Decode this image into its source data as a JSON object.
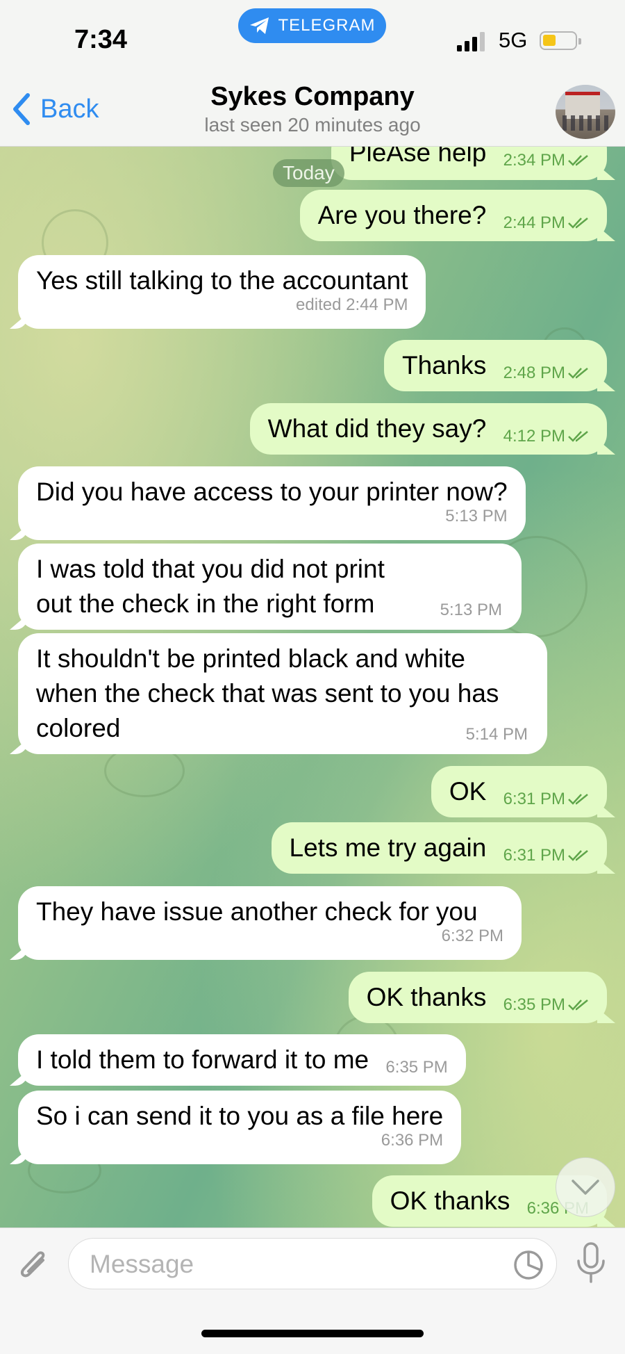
{
  "status_bar": {
    "time": "7:34",
    "app_badge": "TELEGRAM",
    "network": "5G",
    "icons": [
      "telegram-icon",
      "signal-icon",
      "battery-icon"
    ]
  },
  "header": {
    "back_label": "Back",
    "chat_title": "Sykes Company",
    "subtitle": "last seen 20 minutes ago"
  },
  "date_chip": "Today",
  "messages": [
    {
      "dir": "out",
      "text": "PleAse help",
      "time": "2:34 PM",
      "read": true
    },
    {
      "dir": "out",
      "text": "Are you there?",
      "time": "2:44 PM",
      "read": true
    },
    {
      "dir": "in",
      "text": "Yes still talking to the accountant",
      "time": "edited 2:44 PM"
    },
    {
      "dir": "out",
      "text": "Thanks",
      "time": "2:48 PM",
      "read": true
    },
    {
      "dir": "out",
      "text": "What did they say?",
      "time": "4:12 PM",
      "read": true
    },
    {
      "dir": "in",
      "text": "Did you have access to your printer now?",
      "time": "5:13 PM"
    },
    {
      "dir": "in",
      "text": "I was told that you did not print out the check in the right form",
      "time": "5:13 PM"
    },
    {
      "dir": "in",
      "text": "It shouldn't be printed black and white when the check that was sent to you has colored",
      "time": "5:14 PM"
    },
    {
      "dir": "out",
      "text": "OK",
      "time": "6:31 PM",
      "read": true
    },
    {
      "dir": "out",
      "text": "Lets me try again",
      "time": "6:31 PM",
      "read": true
    },
    {
      "dir": "in",
      "text": "They have issue another check for you",
      "time": "6:32 PM"
    },
    {
      "dir": "out",
      "text": "OK thanks",
      "time": "6:35 PM",
      "read": true
    },
    {
      "dir": "in",
      "text": "I told them to forward it to me",
      "time": "6:35 PM"
    },
    {
      "dir": "in",
      "text": "So i can send it to you as a file here",
      "time": "6:36 PM"
    },
    {
      "dir": "out",
      "text": "OK thanks",
      "time": "6:36 PM",
      "read": true
    }
  ],
  "composer": {
    "placeholder": "Message",
    "value": ""
  },
  "colors": {
    "accent": "#2f8cf0",
    "outgoing_bubble": "#e3fbc6",
    "incoming_bubble": "#ffffff",
    "outgoing_time": "#5fa54a"
  }
}
